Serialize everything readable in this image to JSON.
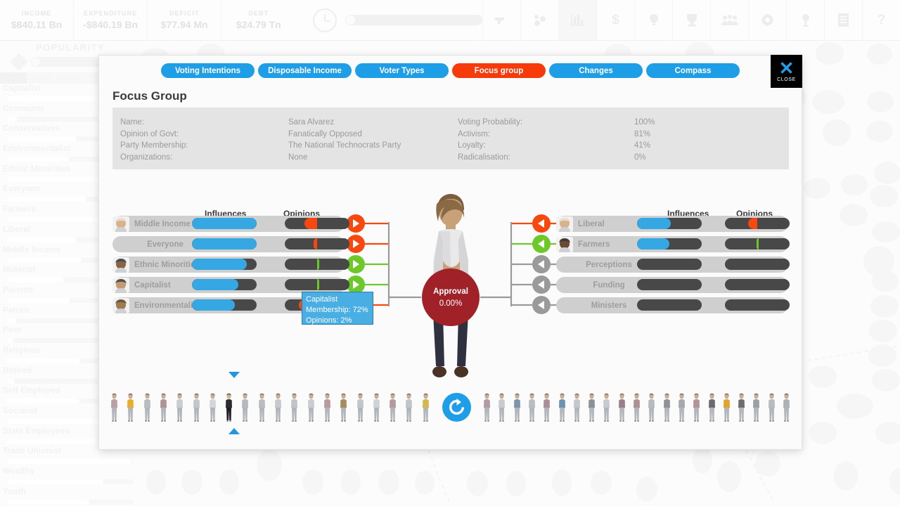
{
  "topbar": {
    "stats": [
      {
        "label": "INCOME",
        "value": "$840.11 Bn",
        "name": "income"
      },
      {
        "label": "EXPENDITURE",
        "value": "-$840.19 Bn",
        "name": "expenditure"
      },
      {
        "label": "DEFICIT",
        "value": "$77.94 Mn",
        "name": "deficit"
      },
      {
        "label": "DEBT",
        "value": "$24.79 Tn",
        "name": "debt"
      }
    ],
    "clock_icon": "clock-icon",
    "turn_progress": 0,
    "tools": [
      {
        "icon": "gun-icon",
        "active": false
      },
      {
        "icon": "situations-icon",
        "active": false
      },
      {
        "icon": "bar-chart-icon",
        "active": true
      },
      {
        "icon": "dollar-icon",
        "active": false
      },
      {
        "icon": "lightbulb-icon",
        "active": false
      },
      {
        "icon": "trophy-icon",
        "active": false
      },
      {
        "icon": "voters-icon",
        "active": false
      },
      {
        "icon": "gear-icon",
        "active": false
      },
      {
        "icon": "medal-icon",
        "active": false
      },
      {
        "icon": "document-icon",
        "active": false
      },
      {
        "icon": "help-icon",
        "active": false
      }
    ]
  },
  "sidebar": {
    "title": "POPULARITY",
    "items": [
      {
        "label": "Capitalist",
        "value": 72
      },
      {
        "label": "Commuter",
        "value": 8
      },
      {
        "label": "Conservatives",
        "value": 55
      },
      {
        "label": "Environmentalist",
        "value": 49
      },
      {
        "label": "Ethnic Minorities",
        "value": 82
      },
      {
        "label": "Everyone",
        "value": 63
      },
      {
        "label": "Farmers",
        "value": 87
      },
      {
        "label": "Liberal",
        "value": 55
      },
      {
        "label": "Middle Income",
        "value": 59
      },
      {
        "label": "Motorist",
        "value": 45
      },
      {
        "label": "Parents",
        "value": 50
      },
      {
        "label": "Patriot",
        "value": 7
      },
      {
        "label": "Poor",
        "value": 5
      },
      {
        "label": "Religious",
        "value": 58
      },
      {
        "label": "Retired",
        "value": 6
      },
      {
        "label": "Self Employed",
        "value": 57
      },
      {
        "label": "Socialist",
        "value": 91
      },
      {
        "label": "State Employees",
        "value": 84
      },
      {
        "label": "Trade Unionist",
        "value": 99
      },
      {
        "label": "Wealthy",
        "value": 76
      },
      {
        "label": "Youth",
        "value": 65
      }
    ]
  },
  "modal": {
    "tabs": [
      {
        "label": "Voting Intentions",
        "selected": false
      },
      {
        "label": "Disposable Income",
        "selected": false
      },
      {
        "label": "Voter Types",
        "selected": false
      },
      {
        "label": "Focus group",
        "selected": true
      },
      {
        "label": "Changes",
        "selected": false
      },
      {
        "label": "Compass",
        "selected": false
      }
    ],
    "close": {
      "glyph": "✕",
      "label": "CLOSE"
    },
    "title": "Focus Group",
    "info": {
      "left_labels": [
        "Name:",
        "Opinion of Govt:",
        "Party Membership:",
        "Organizations:"
      ],
      "left_values": [
        "Sara Alvarez",
        "Fanatically Opposed",
        "The National Technocrats Party",
        "None"
      ],
      "right_labels": [
        "Voting Probability:",
        "Activism:",
        "Loyalty:",
        "Radicalisation:"
      ],
      "right_values": [
        "100%",
        "81%",
        "41%",
        "0%"
      ]
    },
    "left_panel": {
      "col_influences": "Influences",
      "col_opinions": "Opinions",
      "rows": [
        {
          "label": "Middle Income",
          "has_avatar": true,
          "influence": 100,
          "opinion": 0.3,
          "opinion_color": "#f6480f",
          "arrow_color": "#f6480f",
          "arrow": "play-right-icon"
        },
        {
          "label": "Everyone",
          "has_avatar": false,
          "influence": 100,
          "opinion": 0.45,
          "opinion_color": "#f6480f",
          "arrow_color": "#f6480f",
          "arrow": "play-right-icon"
        },
        {
          "label": "Ethnic Minorities",
          "has_avatar": true,
          "influence": 85,
          "opinion": 0.5,
          "opinion_color": "#6dc82a",
          "arrow_color": "#6dc82a",
          "arrow": "play-right-icon"
        },
        {
          "label": "Capitalist",
          "has_avatar": true,
          "influence": 72,
          "opinion": 0.52,
          "opinion_color": "#6dc82a",
          "arrow_color": "#6dc82a",
          "arrow": "play-right-icon"
        },
        {
          "label": "Environmentalist",
          "has_avatar": true,
          "influence": 66,
          "opinion": 0.22,
          "opinion_color": "#f6480f",
          "arrow_color": "#f6480f",
          "arrow": "play-right-icon"
        }
      ]
    },
    "right_panel": {
      "col_influences": "Influences",
      "col_opinions": "Opinions",
      "rows": [
        {
          "label": "Liberal",
          "has_avatar": true,
          "influence": 52,
          "opinion": 0.36,
          "opinion_color": "#f6480f",
          "arrow_color": "#f6480f",
          "arrow": "play-left-icon"
        },
        {
          "label": "Farmers",
          "has_avatar": true,
          "influence": 50,
          "opinion": 0.49,
          "opinion_color": "#6dc82a",
          "arrow_color": "#6dc82a",
          "arrow": "play-left-icon"
        },
        {
          "label": "Perceptions",
          "has_avatar": false,
          "influence": 0,
          "opinion": null,
          "opinion_color": "#9a9a9a",
          "arrow_color": "#9a9a9a",
          "arrow": "play-left-icon"
        },
        {
          "label": "Funding",
          "has_avatar": false,
          "influence": 0,
          "opinion": null,
          "opinion_color": "#9a9a9a",
          "arrow_color": "#9a9a9a",
          "arrow": "play-left-icon"
        },
        {
          "label": "Ministers",
          "has_avatar": false,
          "influence": 0,
          "opinion": null,
          "opinion_color": "#9a9a9a",
          "arrow_color": "#9a9a9a",
          "arrow": "play-left-icon"
        }
      ]
    },
    "approval": {
      "title": "Approval",
      "value": "0.00%",
      "color": "#a02128"
    },
    "tooltip": {
      "title": "Capitalist",
      "line2": "Membership: 72%",
      "line3": "Opinions: 2%",
      "bg": "#49aee4"
    },
    "filmstrip": {
      "refresh_icon": "refresh-icon",
      "selected_index": 7,
      "selector_caret_down": "caret-down-icon",
      "selector_caret_up": "caret-up-icon",
      "left_count": 20,
      "right_count": 21
    }
  }
}
